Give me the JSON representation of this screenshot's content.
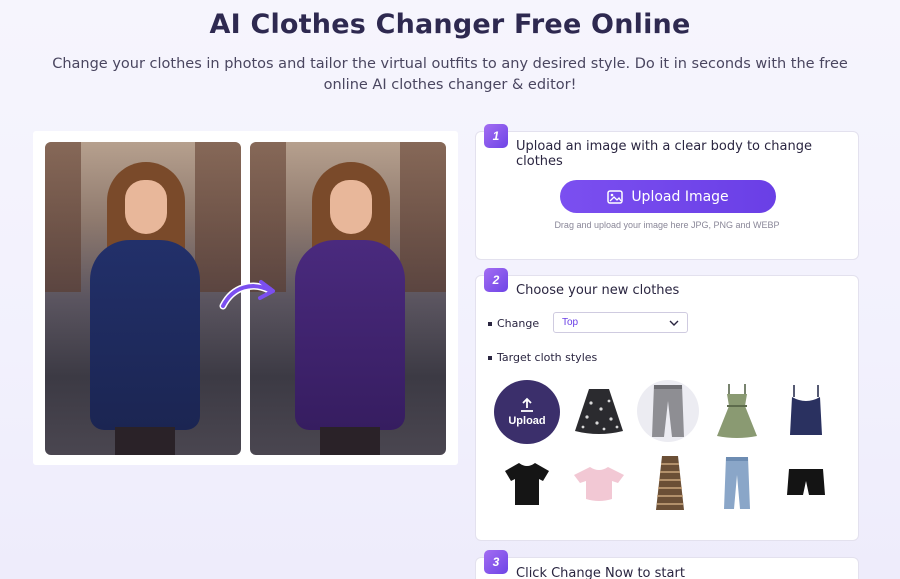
{
  "header": {
    "title": "AI Clothes Changer Free Online",
    "subtitle": "Change your clothes in photos and tailor the virtual outfits to any desired style. Do it in seconds with the free online AI clothes changer & editor!"
  },
  "colors": {
    "accent": "#6a3fe6",
    "dark_tile": "#3b2f6b",
    "text": "#2a2540"
  },
  "step1": {
    "number": "1",
    "title": "Upload an image with a clear body to change clothes",
    "button_label": "Upload Image",
    "hint": "Drag and upload your image here JPG, PNG and WEBP"
  },
  "step2": {
    "number": "2",
    "title": "Choose your new clothes",
    "change_label": "Change",
    "change_value": "Top",
    "styles_label": "Target cloth styles",
    "upload_tile_label": "Upload",
    "styles": [
      {
        "name": "black-floral-skirt-icon"
      },
      {
        "name": "gray-pants-icon"
      },
      {
        "name": "green-sundress-icon"
      },
      {
        "name": "navy-camisole-icon"
      },
      {
        "name": "black-tshirt-icon"
      },
      {
        "name": "pink-crop-top-icon"
      },
      {
        "name": "striped-dress-icon"
      },
      {
        "name": "blue-jeans-icon"
      },
      {
        "name": "black-shorts-icon"
      }
    ]
  },
  "step3": {
    "number": "3",
    "title": "Click Change Now to start"
  }
}
